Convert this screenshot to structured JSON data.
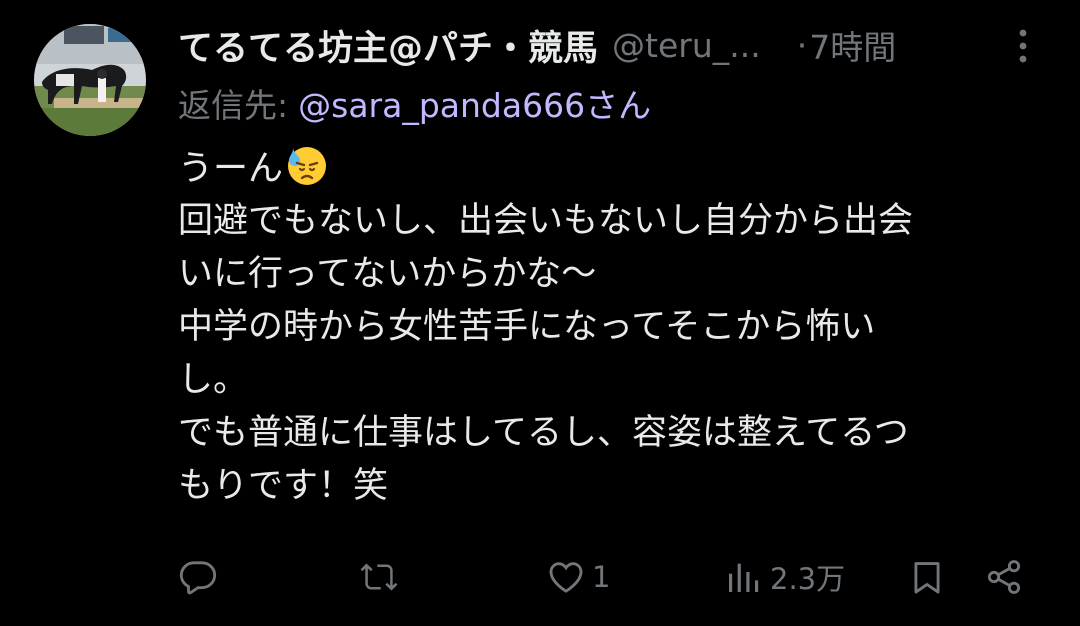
{
  "tweet": {
    "author": {
      "display_name": "てるてる坊主@パチ・競馬",
      "handle": "@teru_...",
      "avatar_icon": "racehorse-avatar"
    },
    "separator": "·",
    "time": "7時間",
    "reply": {
      "prefix": "返信先:",
      "user": "@sara_panda666さん"
    },
    "body": {
      "line1": "うーん",
      "emoji": "sweat-downcast-emoji",
      "line2": "回避でもないし、出会いもないし自分から出会",
      "line3": "いに行ってないからかな〜",
      "line4": "中学の時から女性苦手になってそこから怖い",
      "line5": "し。",
      "line6": "でも普通に仕事はしてるし、容姿は整えてるつ",
      "line7": "もりです！笑"
    },
    "actions": {
      "reply_icon": "reply-icon",
      "reply_count": "",
      "repost_icon": "repost-icon",
      "repost_count": "",
      "like_icon": "heart-icon",
      "like_count": "1",
      "views_icon": "views-icon",
      "views_count": "2.3万",
      "bookmark_icon": "bookmark-icon",
      "share_icon": "share-icon"
    },
    "colors": {
      "background": "#000000",
      "text": "#e7e9ea",
      "muted": "#71767b",
      "mention": "#c2b8ff"
    }
  }
}
